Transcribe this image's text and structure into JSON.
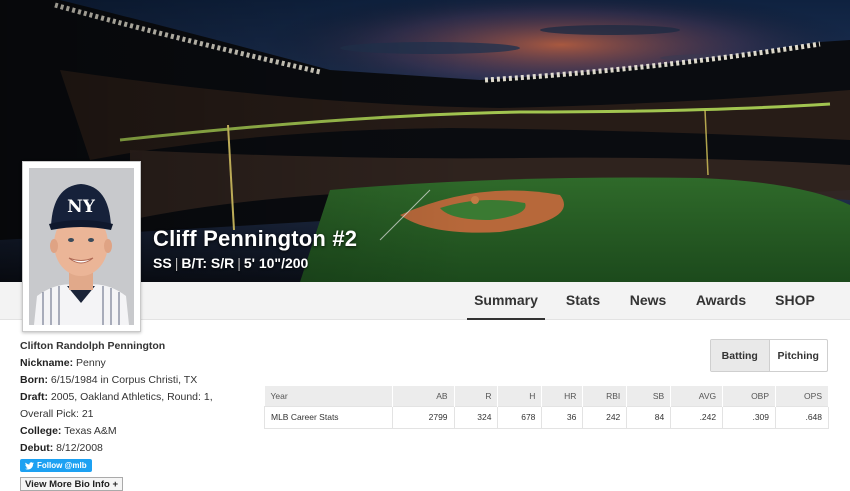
{
  "hero": {
    "name": "Cliff Pennington #2",
    "position": "SS",
    "bats_throws": "B/T: S/R",
    "height_weight": "5' 10\"/200",
    "logo_text": "NY"
  },
  "nav": {
    "tabs": [
      "Summary",
      "Stats",
      "News",
      "Awards",
      "SHOP"
    ],
    "active": "Summary"
  },
  "bio": {
    "full_name": "Clifton Randolph Pennington",
    "nickname_label": "Nickname:",
    "nickname": "Penny",
    "born_label": "Born:",
    "born": "6/15/1984 in Corpus Christi, TX",
    "draft_label": "Draft:",
    "draft": "2005, Oakland Athletics, Round: 1, Overall Pick: 21",
    "college_label": "College:",
    "college": "Texas A&M",
    "debut_label": "Debut:",
    "debut": "8/12/2008",
    "follow_label": "Follow @mlb",
    "more_label": "View More Bio Info +"
  },
  "toggle": {
    "batting": "Batting",
    "pitching": "Pitching",
    "active": "Batting"
  },
  "stats": {
    "headers": [
      "Year",
      "AB",
      "R",
      "H",
      "HR",
      "RBI",
      "SB",
      "AVG",
      "OBP",
      "OPS"
    ],
    "rows": [
      [
        "MLB Career Stats",
        "2799",
        "324",
        "678",
        "36",
        "242",
        "84",
        ".242",
        ".309",
        ".648"
      ]
    ]
  },
  "colors": {
    "twitter": "#1da1f2",
    "nav_bg": "#f3f3f3",
    "table_header_bg": "#ececec"
  }
}
